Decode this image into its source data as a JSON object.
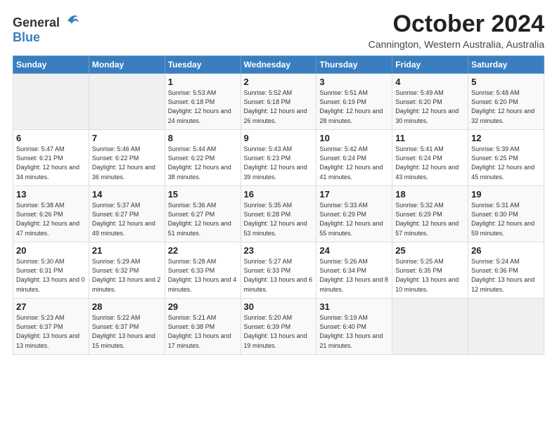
{
  "header": {
    "logo_general": "General",
    "logo_blue": "Blue",
    "month": "October 2024",
    "location": "Cannington, Western Australia, Australia"
  },
  "days_of_week": [
    "Sunday",
    "Monday",
    "Tuesday",
    "Wednesday",
    "Thursday",
    "Friday",
    "Saturday"
  ],
  "weeks": [
    [
      {
        "day": "",
        "info": ""
      },
      {
        "day": "",
        "info": ""
      },
      {
        "day": "1",
        "info": "Sunrise: 5:53 AM\nSunset: 6:18 PM\nDaylight: 12 hours and 24 minutes."
      },
      {
        "day": "2",
        "info": "Sunrise: 5:52 AM\nSunset: 6:18 PM\nDaylight: 12 hours and 26 minutes."
      },
      {
        "day": "3",
        "info": "Sunrise: 5:51 AM\nSunset: 6:19 PM\nDaylight: 12 hours and 28 minutes."
      },
      {
        "day": "4",
        "info": "Sunrise: 5:49 AM\nSunset: 6:20 PM\nDaylight: 12 hours and 30 minutes."
      },
      {
        "day": "5",
        "info": "Sunrise: 5:48 AM\nSunset: 6:20 PM\nDaylight: 12 hours and 32 minutes."
      }
    ],
    [
      {
        "day": "6",
        "info": "Sunrise: 5:47 AM\nSunset: 6:21 PM\nDaylight: 12 hours and 34 minutes."
      },
      {
        "day": "7",
        "info": "Sunrise: 5:46 AM\nSunset: 6:22 PM\nDaylight: 12 hours and 36 minutes."
      },
      {
        "day": "8",
        "info": "Sunrise: 5:44 AM\nSunset: 6:22 PM\nDaylight: 12 hours and 38 minutes."
      },
      {
        "day": "9",
        "info": "Sunrise: 5:43 AM\nSunset: 6:23 PM\nDaylight: 12 hours and 39 minutes."
      },
      {
        "day": "10",
        "info": "Sunrise: 5:42 AM\nSunset: 6:24 PM\nDaylight: 12 hours and 41 minutes."
      },
      {
        "day": "11",
        "info": "Sunrise: 5:41 AM\nSunset: 6:24 PM\nDaylight: 12 hours and 43 minutes."
      },
      {
        "day": "12",
        "info": "Sunrise: 5:39 AM\nSunset: 6:25 PM\nDaylight: 12 hours and 45 minutes."
      }
    ],
    [
      {
        "day": "13",
        "info": "Sunrise: 5:38 AM\nSunset: 6:26 PM\nDaylight: 12 hours and 47 minutes."
      },
      {
        "day": "14",
        "info": "Sunrise: 5:37 AM\nSunset: 6:27 PM\nDaylight: 12 hours and 49 minutes."
      },
      {
        "day": "15",
        "info": "Sunrise: 5:36 AM\nSunset: 6:27 PM\nDaylight: 12 hours and 51 minutes."
      },
      {
        "day": "16",
        "info": "Sunrise: 5:35 AM\nSunset: 6:28 PM\nDaylight: 12 hours and 53 minutes."
      },
      {
        "day": "17",
        "info": "Sunrise: 5:33 AM\nSunset: 6:29 PM\nDaylight: 12 hours and 55 minutes."
      },
      {
        "day": "18",
        "info": "Sunrise: 5:32 AM\nSunset: 6:29 PM\nDaylight: 12 hours and 57 minutes."
      },
      {
        "day": "19",
        "info": "Sunrise: 5:31 AM\nSunset: 6:30 PM\nDaylight: 12 hours and 59 minutes."
      }
    ],
    [
      {
        "day": "20",
        "info": "Sunrise: 5:30 AM\nSunset: 6:31 PM\nDaylight: 13 hours and 0 minutes."
      },
      {
        "day": "21",
        "info": "Sunrise: 5:29 AM\nSunset: 6:32 PM\nDaylight: 13 hours and 2 minutes."
      },
      {
        "day": "22",
        "info": "Sunrise: 5:28 AM\nSunset: 6:33 PM\nDaylight: 13 hours and 4 minutes."
      },
      {
        "day": "23",
        "info": "Sunrise: 5:27 AM\nSunset: 6:33 PM\nDaylight: 13 hours and 6 minutes."
      },
      {
        "day": "24",
        "info": "Sunrise: 5:26 AM\nSunset: 6:34 PM\nDaylight: 13 hours and 8 minutes."
      },
      {
        "day": "25",
        "info": "Sunrise: 5:25 AM\nSunset: 6:35 PM\nDaylight: 13 hours and 10 minutes."
      },
      {
        "day": "26",
        "info": "Sunrise: 5:24 AM\nSunset: 6:36 PM\nDaylight: 13 hours and 12 minutes."
      }
    ],
    [
      {
        "day": "27",
        "info": "Sunrise: 5:23 AM\nSunset: 6:37 PM\nDaylight: 13 hours and 13 minutes."
      },
      {
        "day": "28",
        "info": "Sunrise: 5:22 AM\nSunset: 6:37 PM\nDaylight: 13 hours and 15 minutes."
      },
      {
        "day": "29",
        "info": "Sunrise: 5:21 AM\nSunset: 6:38 PM\nDaylight: 13 hours and 17 minutes."
      },
      {
        "day": "30",
        "info": "Sunrise: 5:20 AM\nSunset: 6:39 PM\nDaylight: 13 hours and 19 minutes."
      },
      {
        "day": "31",
        "info": "Sunrise: 5:19 AM\nSunset: 6:40 PM\nDaylight: 13 hours and 21 minutes."
      },
      {
        "day": "",
        "info": ""
      },
      {
        "day": "",
        "info": ""
      }
    ]
  ]
}
